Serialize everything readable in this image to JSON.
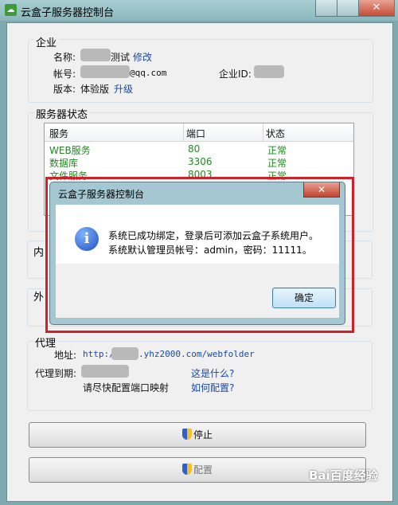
{
  "window": {
    "title": "云盒子服务器控制台",
    "close_glyph": "✕"
  },
  "enterprise": {
    "section_label": "企业",
    "name_label": "名称:",
    "name_suffix": "测试",
    "edit_link": "修改",
    "account_label": "帐号:",
    "account_suffix": "@qq.com",
    "enterprise_id_label": "企业ID:",
    "version_label": "版本:",
    "version_value": "体验版",
    "upgrade_link": "升级"
  },
  "server_status": {
    "section_label": "服务器状态",
    "columns": [
      "服务",
      "端口",
      "状态"
    ],
    "rows": [
      {
        "service": "WEB服务",
        "port": "80",
        "status": "正常"
      },
      {
        "service": "数据库",
        "port": "3306",
        "status": "正常"
      },
      {
        "service": "文件服务",
        "port": "8003",
        "status": "正常"
      }
    ]
  },
  "hidden_sections": {
    "internal_prefix": "内",
    "external_prefix": "外"
  },
  "proxy": {
    "section_label": "代理",
    "address_label": "地址:",
    "address_prefix": "http://",
    "address_suffix": ".yhz2000.com/webfolder",
    "expiry_label": "代理到期:",
    "what_is_link": "这是什么?",
    "config_hint": "请尽快配置端口映射",
    "how_config_link": "如何配置?"
  },
  "buttons": {
    "stop": "停止",
    "config": "配置"
  },
  "dialog": {
    "title": "云盒子服务器控制台",
    "close_glyph": "✕",
    "icon_glyph": "i",
    "line1": "系统已成功绑定，登录后可添加云盒子系统用户。",
    "line2": "系统默认管理员帐号：admin，密码：11111。",
    "ok": "确定"
  },
  "watermark": "Bai百度经验",
  "colors": {
    "highlight_border": "#d0202a",
    "status_green": "#1e8a1e",
    "link_blue": "#1a4aa0"
  }
}
